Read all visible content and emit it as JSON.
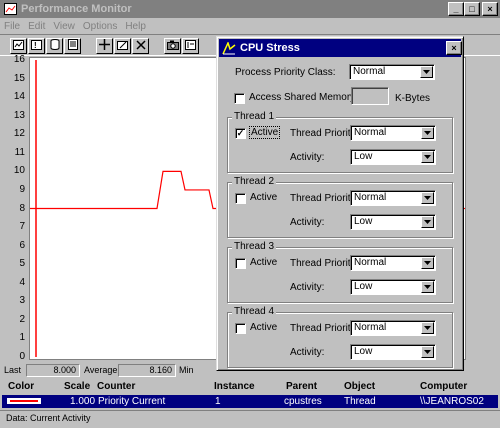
{
  "window": {
    "title": "Performance Monitor",
    "min": "_",
    "max": "□",
    "close": "×"
  },
  "menu": [
    "File",
    "Edit",
    "View",
    "Options",
    "Help"
  ],
  "toolbar_icons": [
    "chart-view-icon",
    "alert-view-icon",
    "log-view-icon",
    "report-view-icon",
    "add-counter-icon",
    "edit-counter-icon",
    "delete-counter-icon",
    "update-now-icon",
    "bookmark-icon"
  ],
  "chart": {
    "y_ticks": [
      "16",
      "15",
      "14",
      "13",
      "12",
      "11",
      "10",
      "9",
      "8",
      "7",
      "6",
      "5",
      "4",
      "3",
      "2",
      "1",
      "0"
    ],
    "ylim": [
      0,
      16
    ]
  },
  "chart_data": {
    "type": "line",
    "title": "",
    "ylim": [
      0,
      16
    ],
    "series": [
      {
        "name": "Priority Current",
        "color": "#ff0000",
        "x": [
          0,
          1,
          2,
          3,
          4,
          5,
          6,
          7,
          8,
          9,
          10,
          11,
          12,
          13,
          14,
          15,
          16,
          17,
          18
        ],
        "values": [
          8,
          8,
          8,
          8,
          8,
          8,
          8,
          8,
          8,
          8,
          8,
          10,
          10,
          9,
          9,
          9,
          8,
          8,
          8
        ]
      }
    ]
  },
  "stats": {
    "last_label": "Last",
    "last_value": "8.000",
    "average_label": "Average",
    "average_value": "8.160",
    "min_label": "Min"
  },
  "legend": {
    "headers": {
      "color": "Color",
      "scale": "Scale",
      "counter": "Counter",
      "instance": "Instance",
      "parent": "Parent",
      "object": "Object",
      "computer": "Computer"
    },
    "row": {
      "scale": "1.000",
      "counter": "Priority Current",
      "instance": "1",
      "parent": "cpustres",
      "object": "Thread",
      "computer": "\\\\JEANROS02",
      "color": "#ff0000"
    }
  },
  "status": "Data: Current Activity",
  "dialog": {
    "title": "CPU Stress",
    "close": "×",
    "process_priority_label": "Process Priority Class:",
    "process_priority_value": "Normal",
    "shared_memory_label": "Access Shared Memory",
    "kbytes_label": "K-Bytes",
    "threads": [
      {
        "label": "Thread 1",
        "active_label": "Active",
        "active": true,
        "priority_label": "Thread Priority:",
        "priority": "Normal",
        "activity_label": "Activity:",
        "activity": "Low"
      },
      {
        "label": "Thread 2",
        "active_label": "Active",
        "active": false,
        "priority_label": "Thread Priority:",
        "priority": "Normal",
        "activity_label": "Activity:",
        "activity": "Low"
      },
      {
        "label": "Thread 3",
        "active_label": "Active",
        "active": false,
        "priority_label": "Thread Priority:",
        "priority": "Normal",
        "activity_label": "Activity:",
        "activity": "Low"
      },
      {
        "label": "Thread 4",
        "active_label": "Active",
        "active": false,
        "priority_label": "Thread Priority:",
        "priority": "Normal",
        "activity_label": "Activity:",
        "activity": "Low"
      }
    ]
  }
}
